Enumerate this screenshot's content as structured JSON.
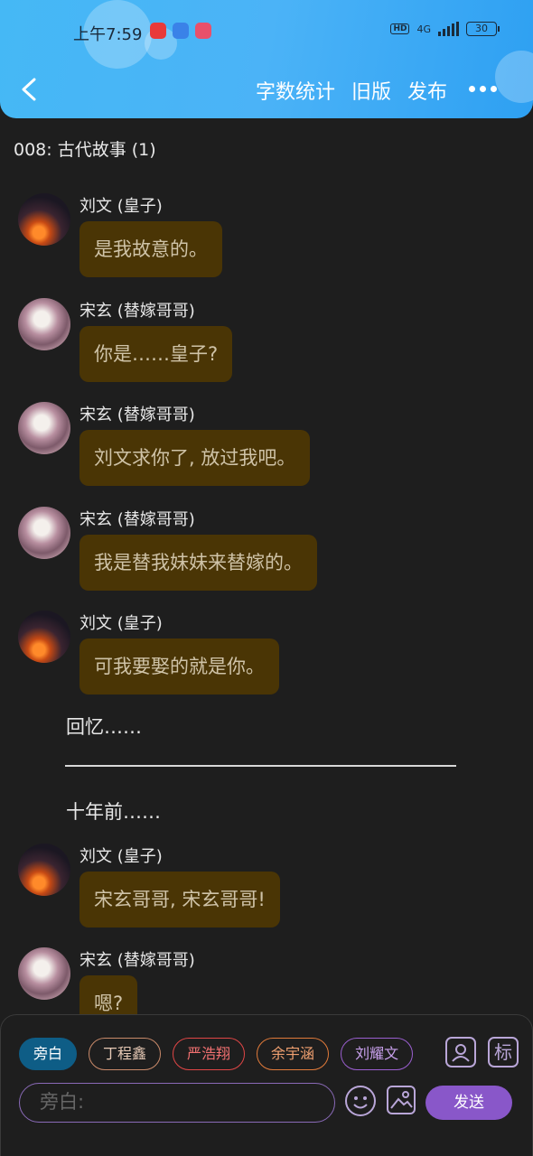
{
  "status": {
    "time": "上午7:59",
    "network": "4G",
    "battery": "30",
    "hd": "HD"
  },
  "header": {
    "word_count": "字数统计",
    "old_version": "旧版",
    "publish": "发布"
  },
  "chapter_title": "008: 古代故事 (1)",
  "messages": [
    {
      "name": "刘文 (皇子)",
      "text": "是我故意的。"
    },
    {
      "name": "宋玄 (替嫁哥哥)",
      "text": "你是……皇子?"
    },
    {
      "name": "宋玄 (替嫁哥哥)",
      "text": "刘文求你了, 放过我吧。"
    },
    {
      "name": "宋玄 (替嫁哥哥)",
      "text": "我是替我妹妹来替嫁的。"
    },
    {
      "name": "刘文 (皇子)",
      "text": "可我要娶的就是你。"
    },
    {
      "name": "刘文 (皇子)",
      "text": "宋玄哥哥, 宋玄哥哥!"
    },
    {
      "name": "宋玄 (替嫁哥哥)",
      "text": "嗯?"
    }
  ],
  "narration": {
    "recall": "回忆……",
    "ten_years": "十年前……"
  },
  "composer": {
    "chips": [
      "旁白",
      "丁程鑫",
      "严浩翔",
      "余宇涵",
      "刘耀文"
    ],
    "tag_icon": "标",
    "placeholder": "旁白:",
    "send": "发送"
  },
  "colors": {
    "header": "#45b8f5",
    "bubble": "#4a3505",
    "send": "#8957c9",
    "active_chip": "#0e5d86"
  }
}
